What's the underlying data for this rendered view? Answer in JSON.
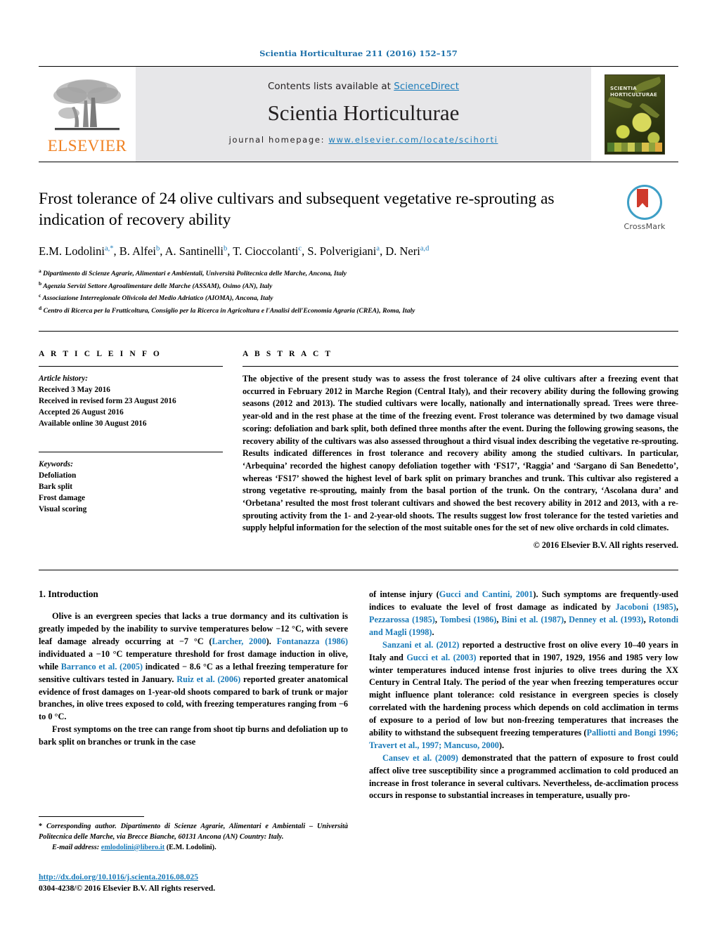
{
  "running_head": "Scientia Horticulturae 211 (2016) 152–157",
  "masthead": {
    "publisher_logo_name": "elsevier-tree-logo",
    "publisher_wordmark": "ELSEVIER",
    "contents_prefix": "Contents lists available at ",
    "contents_link": "ScienceDirect",
    "journal_name": "Scientia Horticulturae",
    "homepage_prefix": "journal homepage: ",
    "homepage_url": "www.elsevier.com/locate/scihorti",
    "cover_title_line1": "SCIENTIA",
    "cover_title_line2": "HORTICULTURAE"
  },
  "article": {
    "title": "Frost tolerance of 24 olive cultivars and subsequent vegetative re-sprouting as indication of recovery ability",
    "authors_html": "E.M. Lodolini<sup>a,</sup><sup>*</sup>, B. Alfei<sup>b</sup>, A. Santinelli<sup>b</sup>, T. Cioccolanti<sup>c</sup>, S. Polverigiani<sup>a</sup>, D. Neri<sup>a,d</sup>",
    "affiliations": [
      "Dipartimento di Scienze Agrarie, Alimentari e Ambientali, Università Politecnica delle Marche, Ancona, Italy",
      "Agenzia Servizi Settore Agroalimentare delle Marche (ASSAM), Osimo (AN), Italy",
      "Associazione Interregionale Olivicola del Medio Adriatico (AIOMA), Ancona, Italy",
      "Centro di Ricerca per la Frutticoltura, Consiglio per la Ricerca in Agricoltura e l'Analisi dell'Economia Agraria (CREA), Roma, Italy"
    ],
    "affiliation_marks": [
      "a",
      "b",
      "c",
      "d"
    ],
    "crossmark_label": "CrossMark"
  },
  "article_info": {
    "heading": "A R T I C L E   I N F O",
    "history_label": "Article history:",
    "history": [
      "Received 3 May 2016",
      "Received in revised form 23 August 2016",
      "Accepted 26 August 2016",
      "Available online 30 August 2016"
    ],
    "keywords_label": "Keywords:",
    "keywords": [
      "Defoliation",
      "Bark split",
      "Frost damage",
      "Visual scoring"
    ]
  },
  "abstract": {
    "heading": "A B S T R A C T",
    "text": "The objective of the present study was to assess the frost tolerance of 24 olive cultivars after a freezing event that occurred in February 2012 in Marche Region (Central Italy), and their recovery ability during the following growing seasons (2012 and 2013). The studied cultivars were locally, nationally and internationally spread. Trees were three-year-old and in the rest phase at the time of the freezing event. Frost tolerance was determined by two damage visual scoring: defoliation and bark split, both defined three months after the event. During the following growing seasons, the recovery ability of the cultivars was also assessed throughout a third visual index describing the vegetative re-sprouting. Results indicated differences in frost tolerance and recovery ability among the studied cultivars. In particular, ‘Arbequina’ recorded the highest canopy defoliation together with ‘FS17’, ‘Raggia’ and ‘Sargano di San Benedetto’, whereas ‘FS17’ showed the highest level of bark split on primary branches and trunk. This cultivar also registered a strong vegetative re-sprouting, mainly from the basal portion of the trunk. On the contrary, ‘Ascolana dura’ and ‘Orbetana’ resulted the most frost tolerant cultivars and showed the best recovery ability in 2012 and 2013, with a re-sprouting activity from the 1- and 2-year-old shoots. The results suggest low frost tolerance for the tested varieties and supply helpful information for the selection of the most suitable ones for the set of new olive orchards in cold climates.",
    "copyright": "© 2016 Elsevier B.V. All rights reserved."
  },
  "introduction": {
    "heading": "1.  Introduction",
    "left_p1_html": "Olive is an evergreen species that lacks a true dormancy and its cultivation is greatly impeded by the inability to survive temperatures below −12 °C, with severe leaf damage already occurring at −7 °C (<span class=\"ref\">Larcher, 2000</span>). <span class=\"ref\">Fontanazza (1986)</span> individuated a −10 °C temperature threshold for frost damage induction in olive, while <span class=\"ref\">Barranco et al. (2005)</span> indicated − 8.6 °C as a lethal freezing temperature for sensitive cultivars tested in January. <span class=\"ref\">Ruiz et al. (2006)</span> reported greater anatomical evidence of frost damages on 1-year-old shoots compared to bark of trunk or major branches, in olive trees exposed to cold, with freezing temperatures ranging from −6 to 0 °C.",
    "left_p2_html": "Frost symptoms on the tree can range from shoot tip burns and defoliation up to bark split on branches or trunk in the case",
    "right_p1_html": "of intense injury (<span class=\"ref\">Gucci and Cantini, 2001</span>). Such symptoms are frequently-used indices to evaluate the level of frost damage as indicated by <span class=\"ref\">Jacoboni (1985)</span>, <span class=\"ref\">Pezzarossa (1985)</span>, <span class=\"ref\">Tombesi (1986)</span>, <span class=\"ref\">Bini et al. (1987)</span>, <span class=\"ref\">Denney et al. (1993)</span>, <span class=\"ref\">Rotondi and Magli (1998)</span>.",
    "right_p2_html": "<span class=\"ref\">Sanzani et al. (2012)</span> reported a destructive frost on olive every 10–40 years in Italy and <span class=\"ref\">Gucci et al. (2003)</span> reported that in 1907, 1929, 1956 and 1985 very low winter temperatures induced intense frost injuries to olive trees during the XX Century in Central Italy. The period of the year when freezing temperatures occur might influence plant tolerance: cold resistance in evergreen species is closely correlated with the hardening process which depends on cold acclimation in terms of exposure to a period of low but non-freezing temperatures that increases the ability to withstand the subsequent freezing temperatures (<span class=\"ref\">Palliotti and Bongi 1996; Travert et al., 1997; Mancuso, 2000</span>).",
    "right_p3_html": "<span class=\"ref\">Cansev et al. (2009)</span> demonstrated that the pattern of exposure to frost could affect olive tree susceptibility since a programmed acclimation to cold produced an increase in frost tolerance in several cultivars. Nevertheless, de-acclimation process occurs in response to substantial increases in temperature, usually pro-"
  },
  "footnote": {
    "corresponding_html": "* <span class=\"ital\">Corresponding author. Dipartimento di Scienze Agrarie, Alimentari e Ambientali – Università Politecnica delle Marche, via Brecce Bianche, 60131 Ancona (AN) Country: Italy.</span>",
    "email_label": "E-mail address:",
    "email": "emlodolini@libero.it",
    "email_owner": "(E.M. Lodolini).",
    "doi": "http://dx.doi.org/10.1016/j.scienta.2016.08.025",
    "issn_line": "0304-4238/© 2016 Elsevier B.V. All rights reserved."
  },
  "colors": {
    "link": "#1a7bb9",
    "elsevier_orange": "#f08122",
    "masthead_grey": "#e7e7e9"
  }
}
